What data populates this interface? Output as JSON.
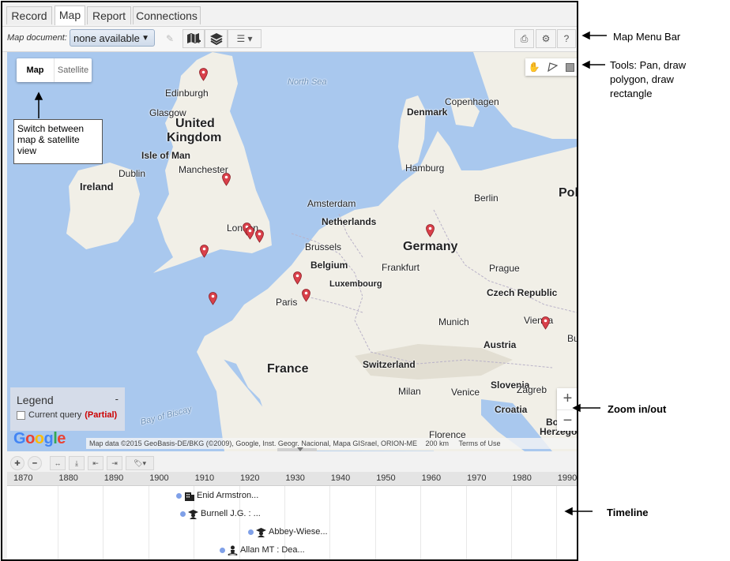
{
  "tabs": [
    {
      "label": "Record",
      "active": false
    },
    {
      "label": "Map",
      "active": true
    },
    {
      "label": "Report",
      "active": false
    },
    {
      "label": "Connections",
      "active": false
    }
  ],
  "toolbar": {
    "map_document_label": "Map document:",
    "map_document_value": "none available"
  },
  "map": {
    "type_options": {
      "map": "Map",
      "satellite": "Satellite",
      "selected": "Map"
    },
    "labels": [
      {
        "text": "North Sea"
      },
      {
        "text": "Edinburgh"
      },
      {
        "text": "Glasgow"
      },
      {
        "text": "United"
      },
      {
        "text": "Kingdom"
      },
      {
        "text": "Isle of Man"
      },
      {
        "text": "Manchester"
      },
      {
        "text": "Dublin"
      },
      {
        "text": "Ireland"
      },
      {
        "text": "London"
      },
      {
        "text": "Copenhagen"
      },
      {
        "text": "Denmark"
      },
      {
        "text": "Hamburg"
      },
      {
        "text": "Amsterdam"
      },
      {
        "text": "Netherlands"
      },
      {
        "text": "Berlin"
      },
      {
        "text": "Pol"
      },
      {
        "text": "Germany"
      },
      {
        "text": "Brussels"
      },
      {
        "text": "Belgium"
      },
      {
        "text": "Frankfurt"
      },
      {
        "text": "Prague"
      },
      {
        "text": "Luxembourg"
      },
      {
        "text": "Paris"
      },
      {
        "text": "Czech Republic"
      },
      {
        "text": "Munich"
      },
      {
        "text": "Vienna"
      },
      {
        "text": "Austria"
      },
      {
        "text": "France"
      },
      {
        "text": "Switzerland"
      },
      {
        "text": "Milan"
      },
      {
        "text": "Venice"
      },
      {
        "text": "Slovenia"
      },
      {
        "text": "Zagreb"
      },
      {
        "text": "Croatia"
      },
      {
        "text": "Bay of Biscay"
      },
      {
        "text": "Florence"
      },
      {
        "text": "Bosni"
      },
      {
        "text": "Herzego"
      },
      {
        "text": "Bu"
      }
    ],
    "legend": {
      "title": "Legend",
      "collapse": "-",
      "item_label": "Current query",
      "item_status": "(Partial)"
    },
    "google_logo": "Google",
    "attribution": "Map data ©2015 GeoBasis-DE/BKG (©2009), Google, Inst. Geogr. Nacional, Mapa GISrael, ORION-ME",
    "scale": "200 km",
    "terms": "Terms of Use",
    "zoom": {
      "in": "+",
      "out": "−"
    }
  },
  "timeline": {
    "years": [
      "1870",
      "1880",
      "1890",
      "1900",
      "1910",
      "1920",
      "1930",
      "1940",
      "1950",
      "1960",
      "1970",
      "1980",
      "1990"
    ],
    "events": [
      {
        "label": "Enid Armstron...",
        "icon": "building-icon"
      },
      {
        "label": "Burnell J.G. : ...",
        "icon": "graduate-icon"
      },
      {
        "label": "Abbey-Wiese...",
        "icon": "graduate-icon"
      },
      {
        "label": "Allan MT : Dea...",
        "icon": "person-pin-icon"
      }
    ]
  },
  "annotations": {
    "menu_bar": "Map Menu Bar",
    "tools_line1": "Tools: Pan, draw",
    "tools_line2": "polygon, draw",
    "tools_line3": "rectangle",
    "switch_line1": "Switch between",
    "switch_line2": "map & satellite",
    "switch_line3": "view",
    "zoom": "Zoom in/out",
    "timeline": "Timeline"
  },
  "colors": {
    "water": "#a9c8ee",
    "land": "#f1efe7",
    "marker": "#d9404a",
    "timeline_dot": "#7fa0e8",
    "partial": "#cc0000"
  }
}
